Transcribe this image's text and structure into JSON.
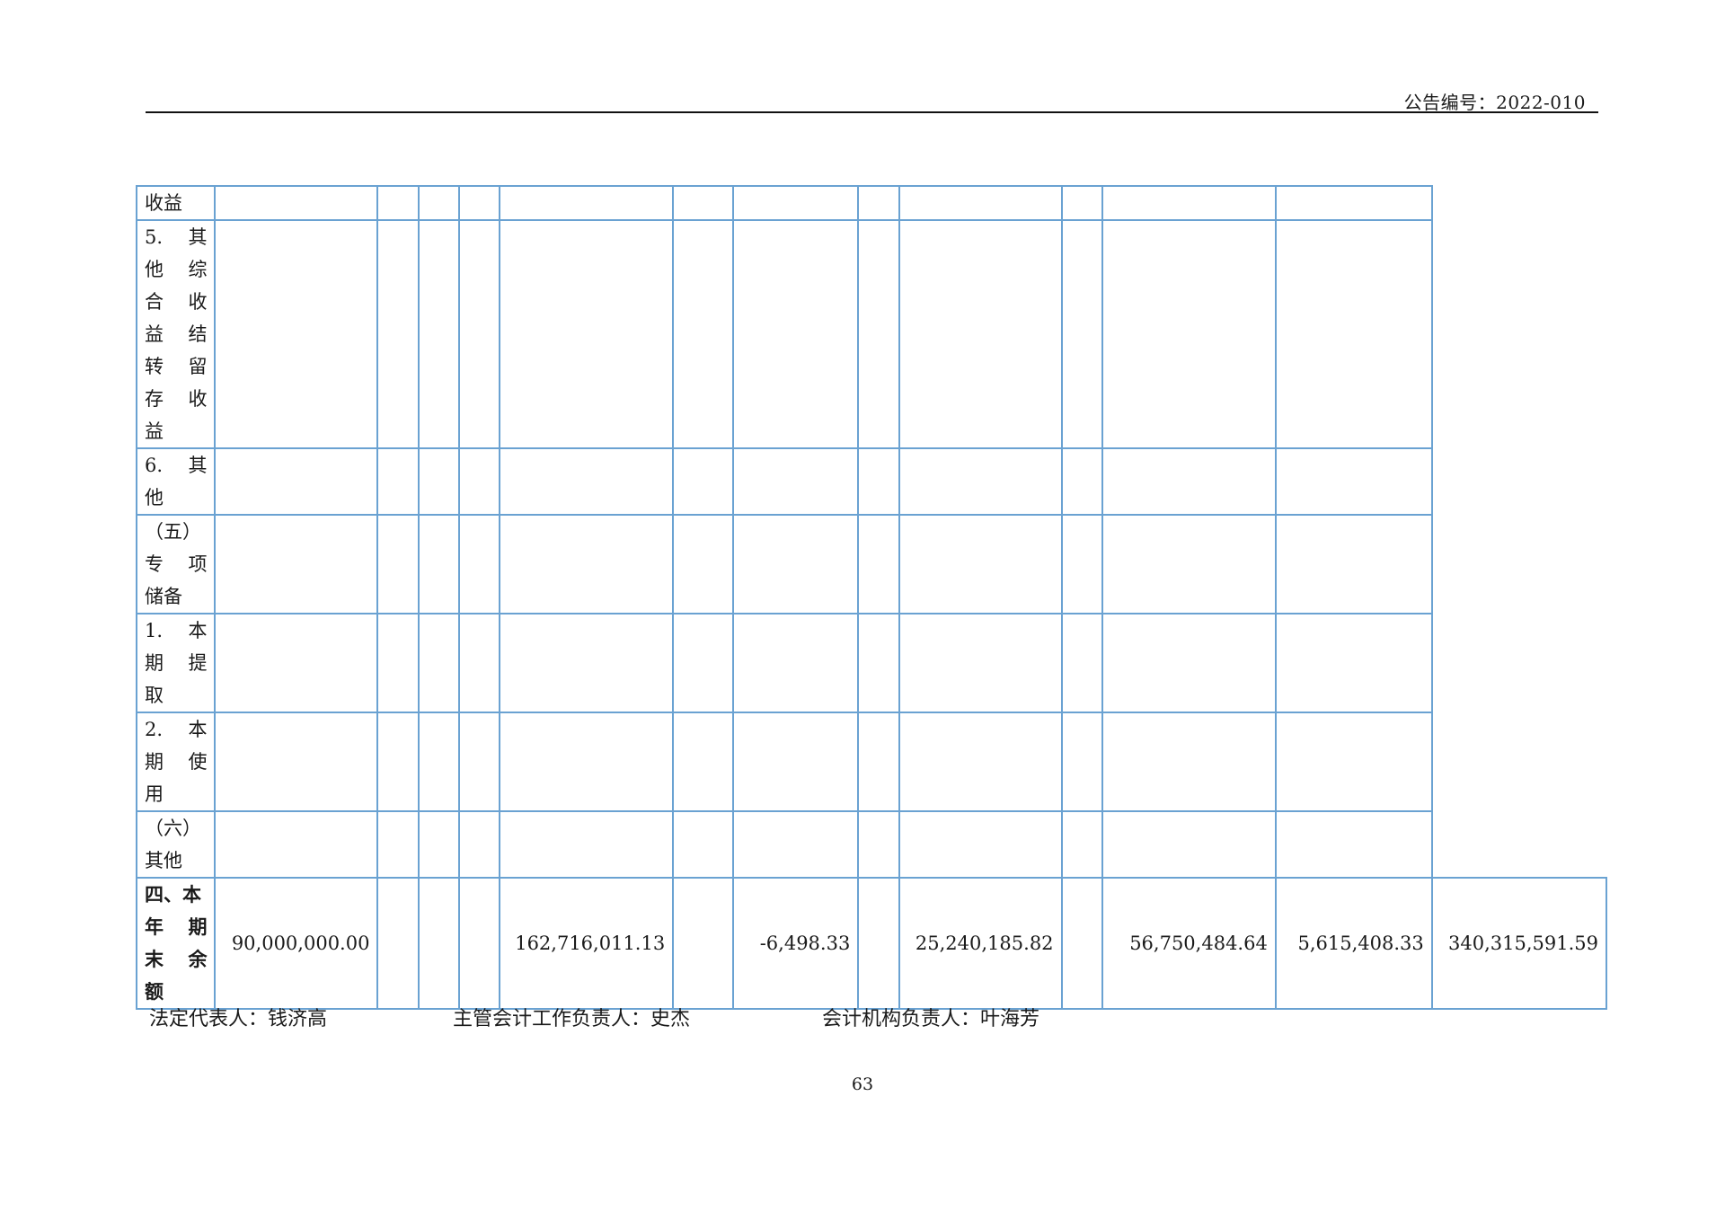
{
  "header": {
    "announcement_no": "公告编号：2022-010"
  },
  "rows": [
    {
      "label": [
        "收益"
      ],
      "values": [
        "",
        "",
        "",
        "",
        "",
        "",
        "",
        "",
        "",
        "",
        "",
        ""
      ]
    },
    {
      "label": [
        "5. 其",
        "他 综",
        "合 收",
        "益 结",
        "转 留",
        "存 收",
        "益"
      ],
      "values": [
        "",
        "",
        "",
        "",
        "",
        "",
        "",
        "",
        "",
        "",
        "",
        ""
      ]
    },
    {
      "label": [
        "6. 其",
        "他"
      ],
      "values": [
        "",
        "",
        "",
        "",
        "",
        "",
        "",
        "",
        "",
        "",
        "",
        ""
      ]
    },
    {
      "label": [
        "（五）",
        "专 项",
        "储备"
      ],
      "values": [
        "",
        "",
        "",
        "",
        "",
        "",
        "",
        "",
        "",
        "",
        "",
        ""
      ]
    },
    {
      "label": [
        "1. 本",
        "期 提",
        "取"
      ],
      "values": [
        "",
        "",
        "",
        "",
        "",
        "",
        "",
        "",
        "",
        "",
        "",
        ""
      ]
    },
    {
      "label": [
        "2. 本",
        "期 使",
        "用"
      ],
      "values": [
        "",
        "",
        "",
        "",
        "",
        "",
        "",
        "",
        "",
        "",
        "",
        ""
      ]
    },
    {
      "label": [
        "（六）",
        "其他"
      ],
      "values": [
        "",
        "",
        "",
        "",
        "",
        "",
        "",
        "",
        "",
        "",
        "",
        ""
      ]
    },
    {
      "label": [
        "四、本",
        "年 期",
        "末 余",
        "额"
      ],
      "bold": true,
      "values": [
        "90,000,000.00",
        "",
        "",
        "",
        "162,716,011.13",
        "",
        "-6,498.33",
        "",
        "25,240,185.82",
        "",
        "56,750,484.64",
        "5,615,408.33",
        "340,315,591.59"
      ]
    }
  ],
  "footer": {
    "legal_rep": "法定代表人：钱济高",
    "accounting_head": "主管会计工作负责人：史杰",
    "accounting_org_head": "会计机构负责人：叶海芳"
  },
  "page_number": "63"
}
